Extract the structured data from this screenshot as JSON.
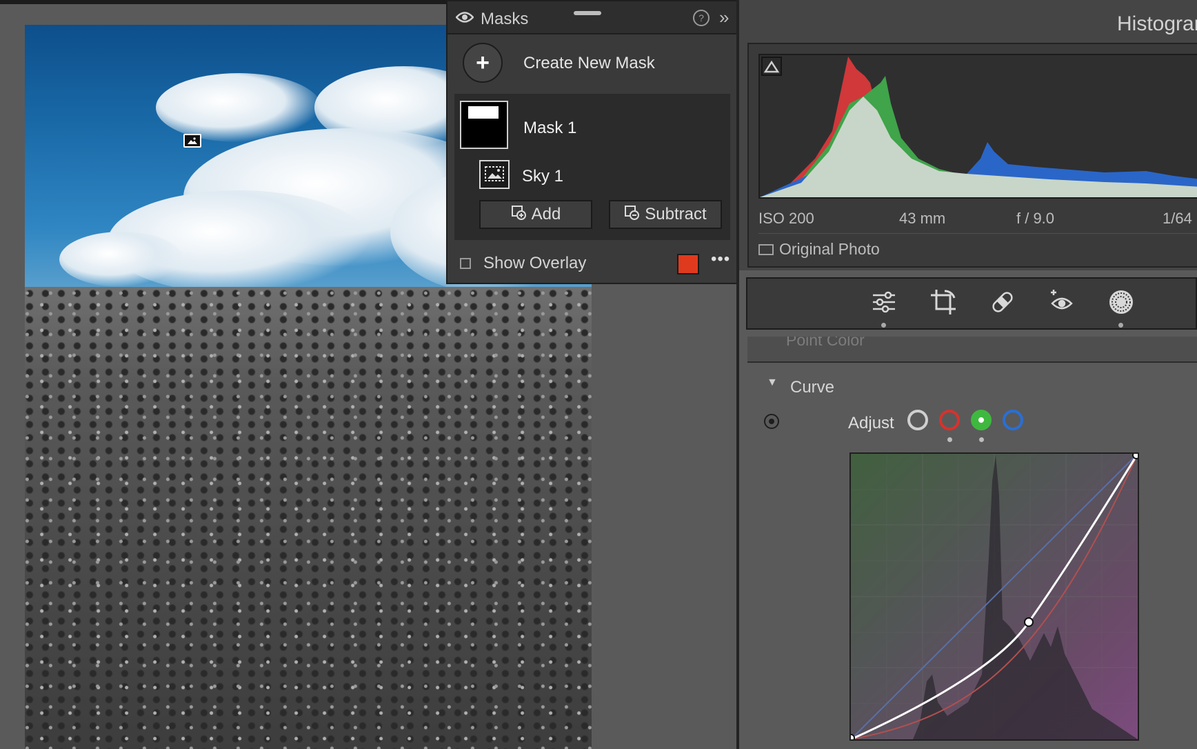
{
  "masks_panel": {
    "title": "Masks",
    "help_label": "?",
    "collapse_label": "»",
    "create_label": "Create New Mask",
    "mask_name": "Mask 1",
    "component_name": "Sky 1",
    "add_label": "Add",
    "subtract_label": "Subtract",
    "overlay_label": "Show Overlay",
    "overlay_checked": false,
    "overlay_color": "#e03a1e",
    "more_label": "•••"
  },
  "histogram": {
    "title": "Histogram",
    "iso": "ISO 200",
    "focal_length": "43 mm",
    "aperture": "f / 9.0",
    "shutter": "1/64",
    "original_photo_label": "Original Photo",
    "original_photo_checked": false
  },
  "toolbar": {
    "tools": [
      {
        "name": "edit",
        "icon": "sliders-icon",
        "active_dot": true
      },
      {
        "name": "crop",
        "icon": "crop-icon",
        "active_dot": false
      },
      {
        "name": "heal",
        "icon": "bandage-icon",
        "active_dot": false
      },
      {
        "name": "red-eye",
        "icon": "red-eye-icon",
        "active_dot": false
      },
      {
        "name": "masking",
        "icon": "masking-icon",
        "active_dot": true
      }
    ]
  },
  "panels": {
    "point_color_label": "Point Color",
    "curve_label": "Curve",
    "adjust_label": "Adjust",
    "channels": [
      {
        "name": "rgb",
        "color": "#cfcfcf",
        "selected": false,
        "dot": false
      },
      {
        "name": "red",
        "color": "#d8322d",
        "selected": false,
        "dot": true
      },
      {
        "name": "green",
        "color": "#3fb83f",
        "selected": true,
        "dot": true
      },
      {
        "name": "blue",
        "color": "#2a6fd4",
        "selected": false,
        "dot": false
      }
    ]
  }
}
